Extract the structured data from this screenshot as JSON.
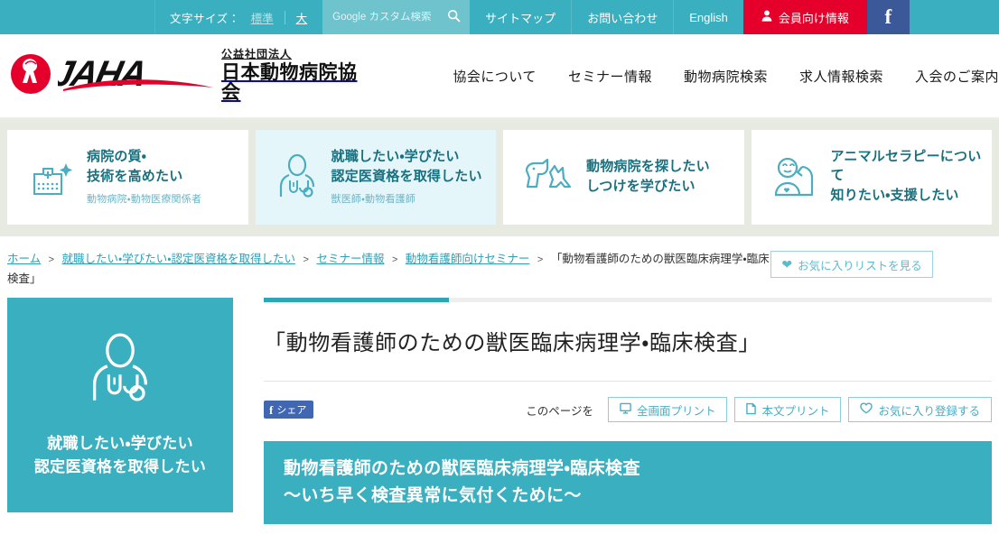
{
  "topbar": {
    "fontsize_label": "文字サイズ：",
    "size_normal": "標準",
    "size_large": "大",
    "search_placeholder": "Google カスタム検索",
    "search_value": "",
    "search_icon": "search-icon",
    "links": [
      {
        "label": "サイトマップ"
      },
      {
        "label": "お問い合わせ"
      },
      {
        "label": "English"
      }
    ],
    "member_label": "会員向け情報",
    "member_icon": "person-icon",
    "member_color": "#e4002b",
    "facebook_icon": "facebook-icon",
    "facebook_color": "#3b5998",
    "bar_color": "#3aafbf"
  },
  "header": {
    "logo_abbr": "JAHA",
    "logo_kana": "公益社団法人",
    "logo_name": "日本動物病院協会",
    "logo_mark_color": "#e4002b",
    "nav": [
      {
        "label": "協会について"
      },
      {
        "label": "セミナー情報"
      },
      {
        "label": "動物病院検索"
      },
      {
        "label": "求人情報検索"
      },
      {
        "label": "入会のご案内"
      }
    ]
  },
  "categories": [
    {
      "icon": "hospital-sparkle-icon",
      "title_line1": "病院の質・",
      "title_line2": "技術を高めたい",
      "sub": "動物病院・動物医療関係者",
      "active": false
    },
    {
      "icon": "doctor-stethoscope-icon",
      "title_line1": "就職したい・学びたい",
      "title_line2": "認定医資格を取得したい",
      "sub": "獣医師・動物看護師",
      "active": true
    },
    {
      "icon": "dog-cat-icon",
      "title_line1": "動物病院を探したい",
      "title_line2": "しつけを学びたい",
      "sub": "",
      "active": false
    },
    {
      "icon": "animal-therapy-icon",
      "title_line1": "アニマルセラピーについて",
      "title_line2": "知りたい・支援したい",
      "sub": "",
      "active": false
    }
  ],
  "breadcrumb": {
    "items": [
      {
        "label": "ホーム",
        "link": true
      },
      {
        "label": "就職したい・学びたい・認定医資格を取得したい",
        "link": true
      },
      {
        "label": "セミナー情報",
        "link": true
      },
      {
        "label": "動物看護師向けセミナー",
        "link": true
      },
      {
        "label": "「動物看護師のための獣医臨床病理学・臨床検査」",
        "link": false
      }
    ],
    "separator": ">",
    "favorites_button": "お気に入りリストを見る",
    "favorites_icon": "heart-filled-icon"
  },
  "sidebar": {
    "icon": "doctor-stethoscope-icon",
    "title_line1": "就職したい・学びたい",
    "title_line2": "認定医資格を取得したい",
    "bg_color": "#3aafbf"
  },
  "main": {
    "page_title": "「動物看護師のための獣医臨床病理学・臨床検査」",
    "accent_color": "#2da7b8",
    "share_label": "シェア",
    "share_icon": "facebook-icon",
    "this_page_label": "このページを",
    "actions": [
      {
        "label": "全画面プリント",
        "icon": "monitor-print-icon"
      },
      {
        "label": "本文プリント",
        "icon": "document-print-icon"
      },
      {
        "label": "お気に入り登録する",
        "icon": "heart-outline-icon"
      }
    ],
    "content_heading_line1": "動物看護師のための獣医臨床病理学・臨床検査",
    "content_heading_line2": "～いち早く検査異常に気付くために～"
  }
}
